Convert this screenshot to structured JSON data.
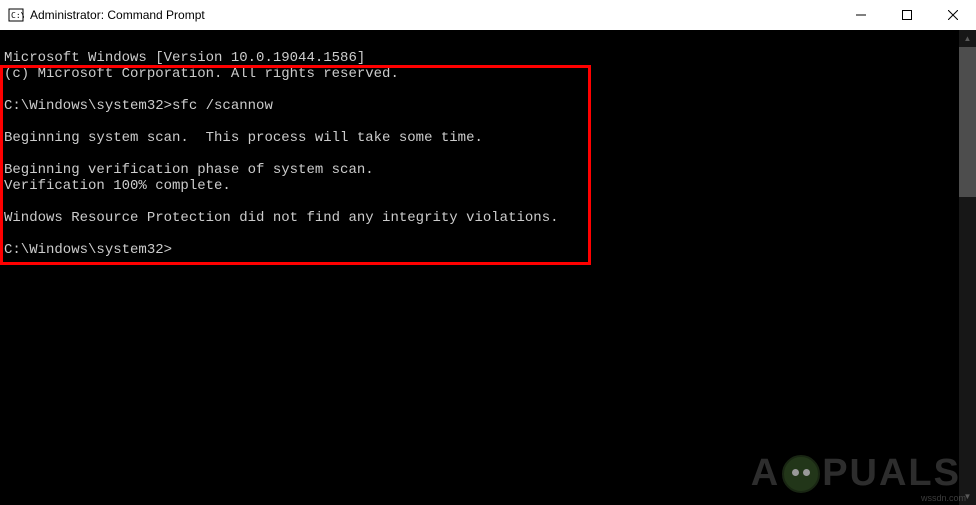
{
  "titlebar": {
    "title": "Administrator: Command Prompt"
  },
  "terminal": {
    "line1": "Microsoft Windows [Version 10.0.19044.1586]",
    "line2": "(c) Microsoft Corporation. All rights reserved.",
    "blank1": "",
    "prompt1": "C:\\Windows\\system32>sfc /scannow",
    "blank2": "",
    "line3": "Beginning system scan.  This process will take some time.",
    "blank3": "",
    "line4": "Beginning verification phase of system scan.",
    "line5": "Verification 100% complete.",
    "blank4": "",
    "line6": "Windows Resource Protection did not find any integrity violations.",
    "blank5": "",
    "prompt2": "C:\\Windows\\system32>"
  },
  "watermark": {
    "part1": "A",
    "part2": "PUALS",
    "credit": "wssdn.com"
  }
}
